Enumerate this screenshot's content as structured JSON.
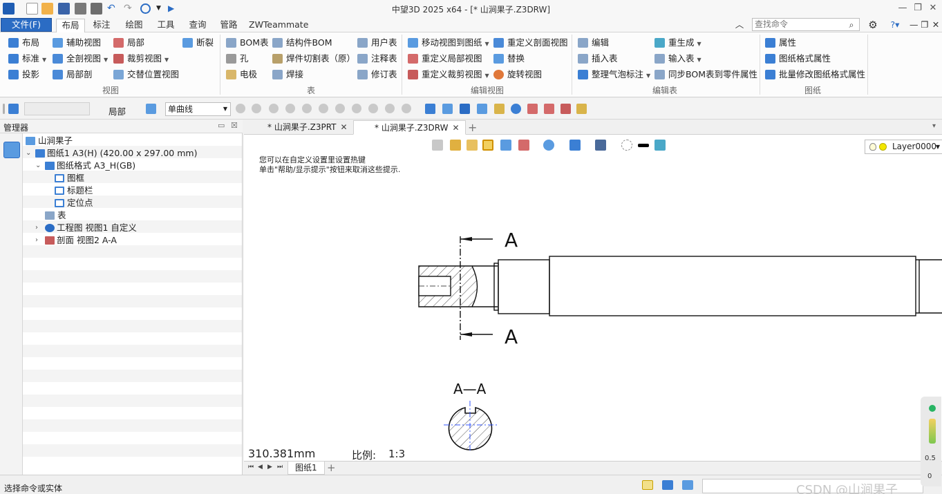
{
  "title": "中望3D 2025 x64 - [* 山涧果子.Z3DRW]",
  "tabs": {
    "file": "文件(F)",
    "items": [
      "布局",
      "标注",
      "绘图",
      "工具",
      "查询",
      "管路",
      "ZWTeammate"
    ]
  },
  "search": {
    "placeholder": "查找命令"
  },
  "ribbon": {
    "view_group": {
      "label": "视图",
      "buttons": [
        "布局",
        "辅助视图",
        "局部",
        "断裂",
        "标准",
        "全剖视图",
        "裁剪视图",
        "投影",
        "局部剖",
        "交替位置视图"
      ]
    },
    "table_group": {
      "label": "表",
      "buttons": [
        "BOM表",
        "结构件BOM",
        "用户表",
        "孔",
        "焊件切割表（原）",
        "注释表",
        "电极",
        "焊接",
        "修订表"
      ]
    },
    "edit_view_group": {
      "label": "编辑视图",
      "buttons": [
        "移动视图到图纸",
        "重定义剖面视图",
        "重定义局部视图",
        "替换",
        "重定义裁剪视图",
        "旋转视图"
      ]
    },
    "edit_table_group": {
      "label": "编辑表",
      "buttons": [
        "编辑",
        "重生成",
        "插入表",
        "输入表",
        "整理气泡标注",
        "同步BOM表到零件属性"
      ]
    },
    "sheet_group": {
      "label": "图纸",
      "buttons": [
        "属性",
        "图纸格式属性",
        "批量修改图纸格式属性"
      ]
    }
  },
  "toolbar": {
    "local_label": "局部",
    "curve_type": "单曲线"
  },
  "manager": {
    "title": "管理器",
    "tree": [
      "山涧果子",
      "图纸1 A3(H) (420.00 x 297.00 mm)",
      "图纸格式 A3_H(GB)",
      "图框",
      "标题栏",
      "定位点",
      "表",
      "工程图 视图1 自定义",
      "剖面 视图2 A-A"
    ]
  },
  "doc_tabs": [
    "* 山涧果子.Z3PRT",
    "* 山涧果子.Z3DRW"
  ],
  "canvas": {
    "layer": "Layer0000",
    "hint_line1": "您可以在自定义设置里设置热键",
    "hint_line2": "单击\"帮助/显示提示\"按钮来取消这些提示.",
    "section_letter": "A",
    "section_title": "A—A",
    "measure": "310.381mm",
    "scale_label": "比例:",
    "scale_value": "1:3"
  },
  "sheet_tab": "图纸1",
  "status": {
    "text": "选择命令或实体"
  },
  "gauge": {
    "top_value": "0.5",
    "bottom_value": "0"
  },
  "watermark": "CSDN @山涧果子",
  "colors": {
    "file_tab": "#2b6cc4",
    "accent_blue": "#2b6cc4"
  }
}
